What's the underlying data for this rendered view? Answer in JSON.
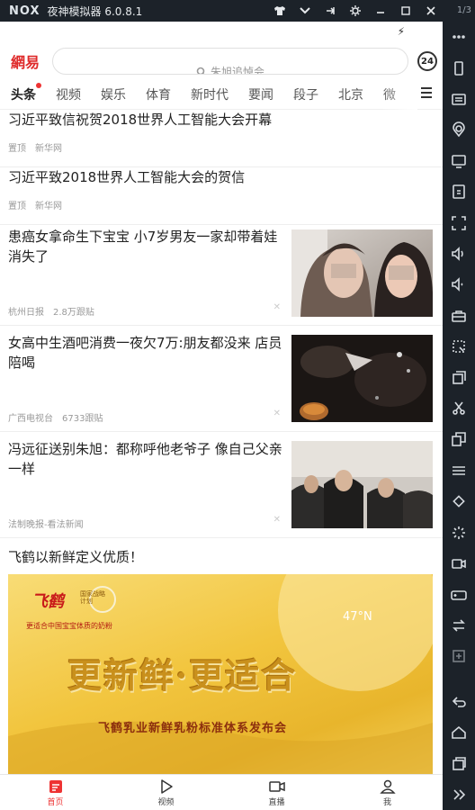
{
  "emulator": {
    "logo": "NOX",
    "title": "夜神模拟器 6.0.8.1",
    "page_counter": "1/3",
    "titlebar_icons": [
      "shirt-icon",
      "chevron-down-icon",
      "pin-icon",
      "gear-icon",
      "minimize-icon",
      "maximize-icon",
      "close-icon"
    ],
    "sidebar_icons": [
      "more-icon",
      "phone-rotate-icon",
      "keyboard-icon",
      "location-icon",
      "screen-icon",
      "apk-icon",
      "fullscreen-icon",
      "volume-up-icon",
      "volume-down-icon",
      "toolbox-icon",
      "screenshot-icon",
      "multi-open-icon",
      "scissors-icon",
      "multi-window-icon",
      "menu-icon",
      "shake-icon",
      "loading-icon",
      "record-icon",
      "gamepad-icon",
      "sync-icon",
      "add-icon",
      "back-icon",
      "home-icon",
      "recent-apps-icon",
      "expand-icon"
    ]
  },
  "header": {
    "logo": "網易",
    "search_placeholder": "朱旭追悼会",
    "hot_badge": "24"
  },
  "tabs": [
    "头条",
    "视频",
    "娱乐",
    "体育",
    "新时代",
    "要闻",
    "段子",
    "北京",
    "微"
  ],
  "news": [
    {
      "title": "习近平致信祝贺2018世界人工智能大会开幕",
      "tag": "置顶",
      "source": "新华网",
      "comments": ""
    },
    {
      "title": "习近平致2018世界人工智能大会的贺信",
      "tag": "置顶",
      "source": "新华网",
      "comments": ""
    },
    {
      "title": "患癌女拿命生下宝宝 小7岁男友一家却带着娃消失了",
      "tag": "",
      "source": "杭州日报",
      "comments": "2.8万跟贴"
    },
    {
      "title": "女高中生酒吧消费一夜欠7万:朋友都没来 店员陪喝",
      "tag": "",
      "source": "广西电视台",
      "comments": "6733跟贴"
    },
    {
      "title": "冯远征送别朱旭：都称呼他老爷子 像自己父亲一样",
      "tag": "",
      "source": "法制晚报-看法新闻",
      "comments": ""
    }
  ],
  "ad": {
    "headline": "飞鹤以新鲜定义优质！",
    "brand": "飞鹤",
    "brand_sub": "国家战略计划",
    "slogan_small": "更适合中国宝宝体质的奶粉",
    "latitude": "47°N",
    "big_text": "更新鲜·更适合",
    "event": "飞鹤乳业新鲜乳粉标准体系发布会"
  },
  "bottom_nav": [
    {
      "label": "首页",
      "icon": "home-news-icon",
      "active": true
    },
    {
      "label": "视频",
      "icon": "play-icon",
      "active": false
    },
    {
      "label": "直播",
      "icon": "camera-icon",
      "active": false
    },
    {
      "label": "我",
      "icon": "user-icon",
      "active": false
    }
  ],
  "colors": {
    "accent": "#e33333",
    "emulator_bg": "#1c2229"
  }
}
